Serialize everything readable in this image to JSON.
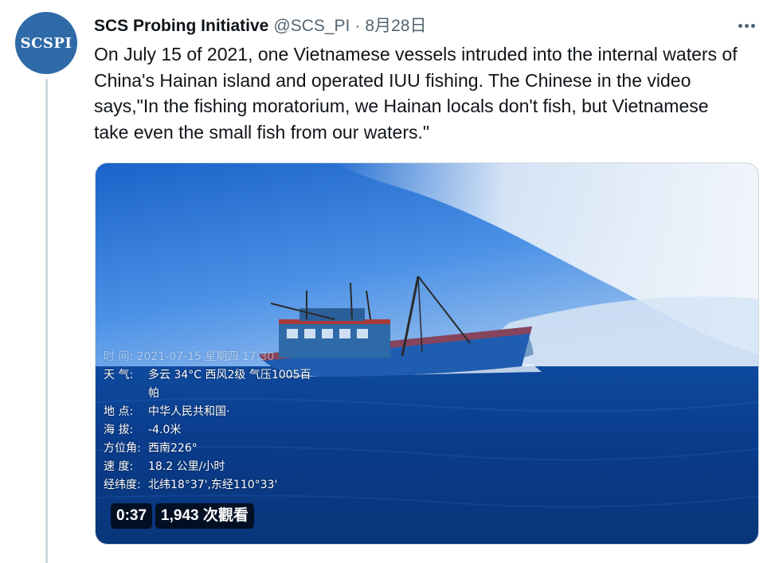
{
  "author": {
    "avatar_text": "SCSPI",
    "display_name": "SCS Probing Initiative",
    "handle": "@SCS_PI",
    "separator": "·",
    "timestamp": "8月28日"
  },
  "tweet": {
    "text": "On July 15 of 2021, one Vietnamese vessels intruded into the internal waters of China's Hainan island and operated IUU fishing. The Chinese in the video says,\"In the fishing moratorium, we Hainan locals don't fish, but Vietnamese take even the small fish from our waters.\""
  },
  "more_icon": "more-horizontal-icon",
  "video": {
    "overlay": {
      "time_row": "时    间: 2021-07-15  星期四 17:30",
      "weather_label": "天    气:",
      "weather_value": "多云 34°C  西风2级  气压1005百",
      "weather_value_cont": "帕",
      "location_label": "地    点:",
      "location_value": "中华人民共和国·",
      "altitude_label": "海    拔:",
      "altitude_value": "-4.0米",
      "azimuth_label": "方位角:",
      "azimuth_value": "西南226°",
      "speed_label": "速    度:",
      "speed_value": "18.2 公里/小时",
      "coords_label": "经纬度:",
      "coords_value": "北纬18°37',东经110°33'"
    },
    "duration": "0:37",
    "views": "1,943 次觀看"
  },
  "colors": {
    "text_primary": "#0f1419",
    "text_secondary": "#536471",
    "avatar_bg": "#2f6aa8",
    "thread_line": "#cfd9de"
  }
}
